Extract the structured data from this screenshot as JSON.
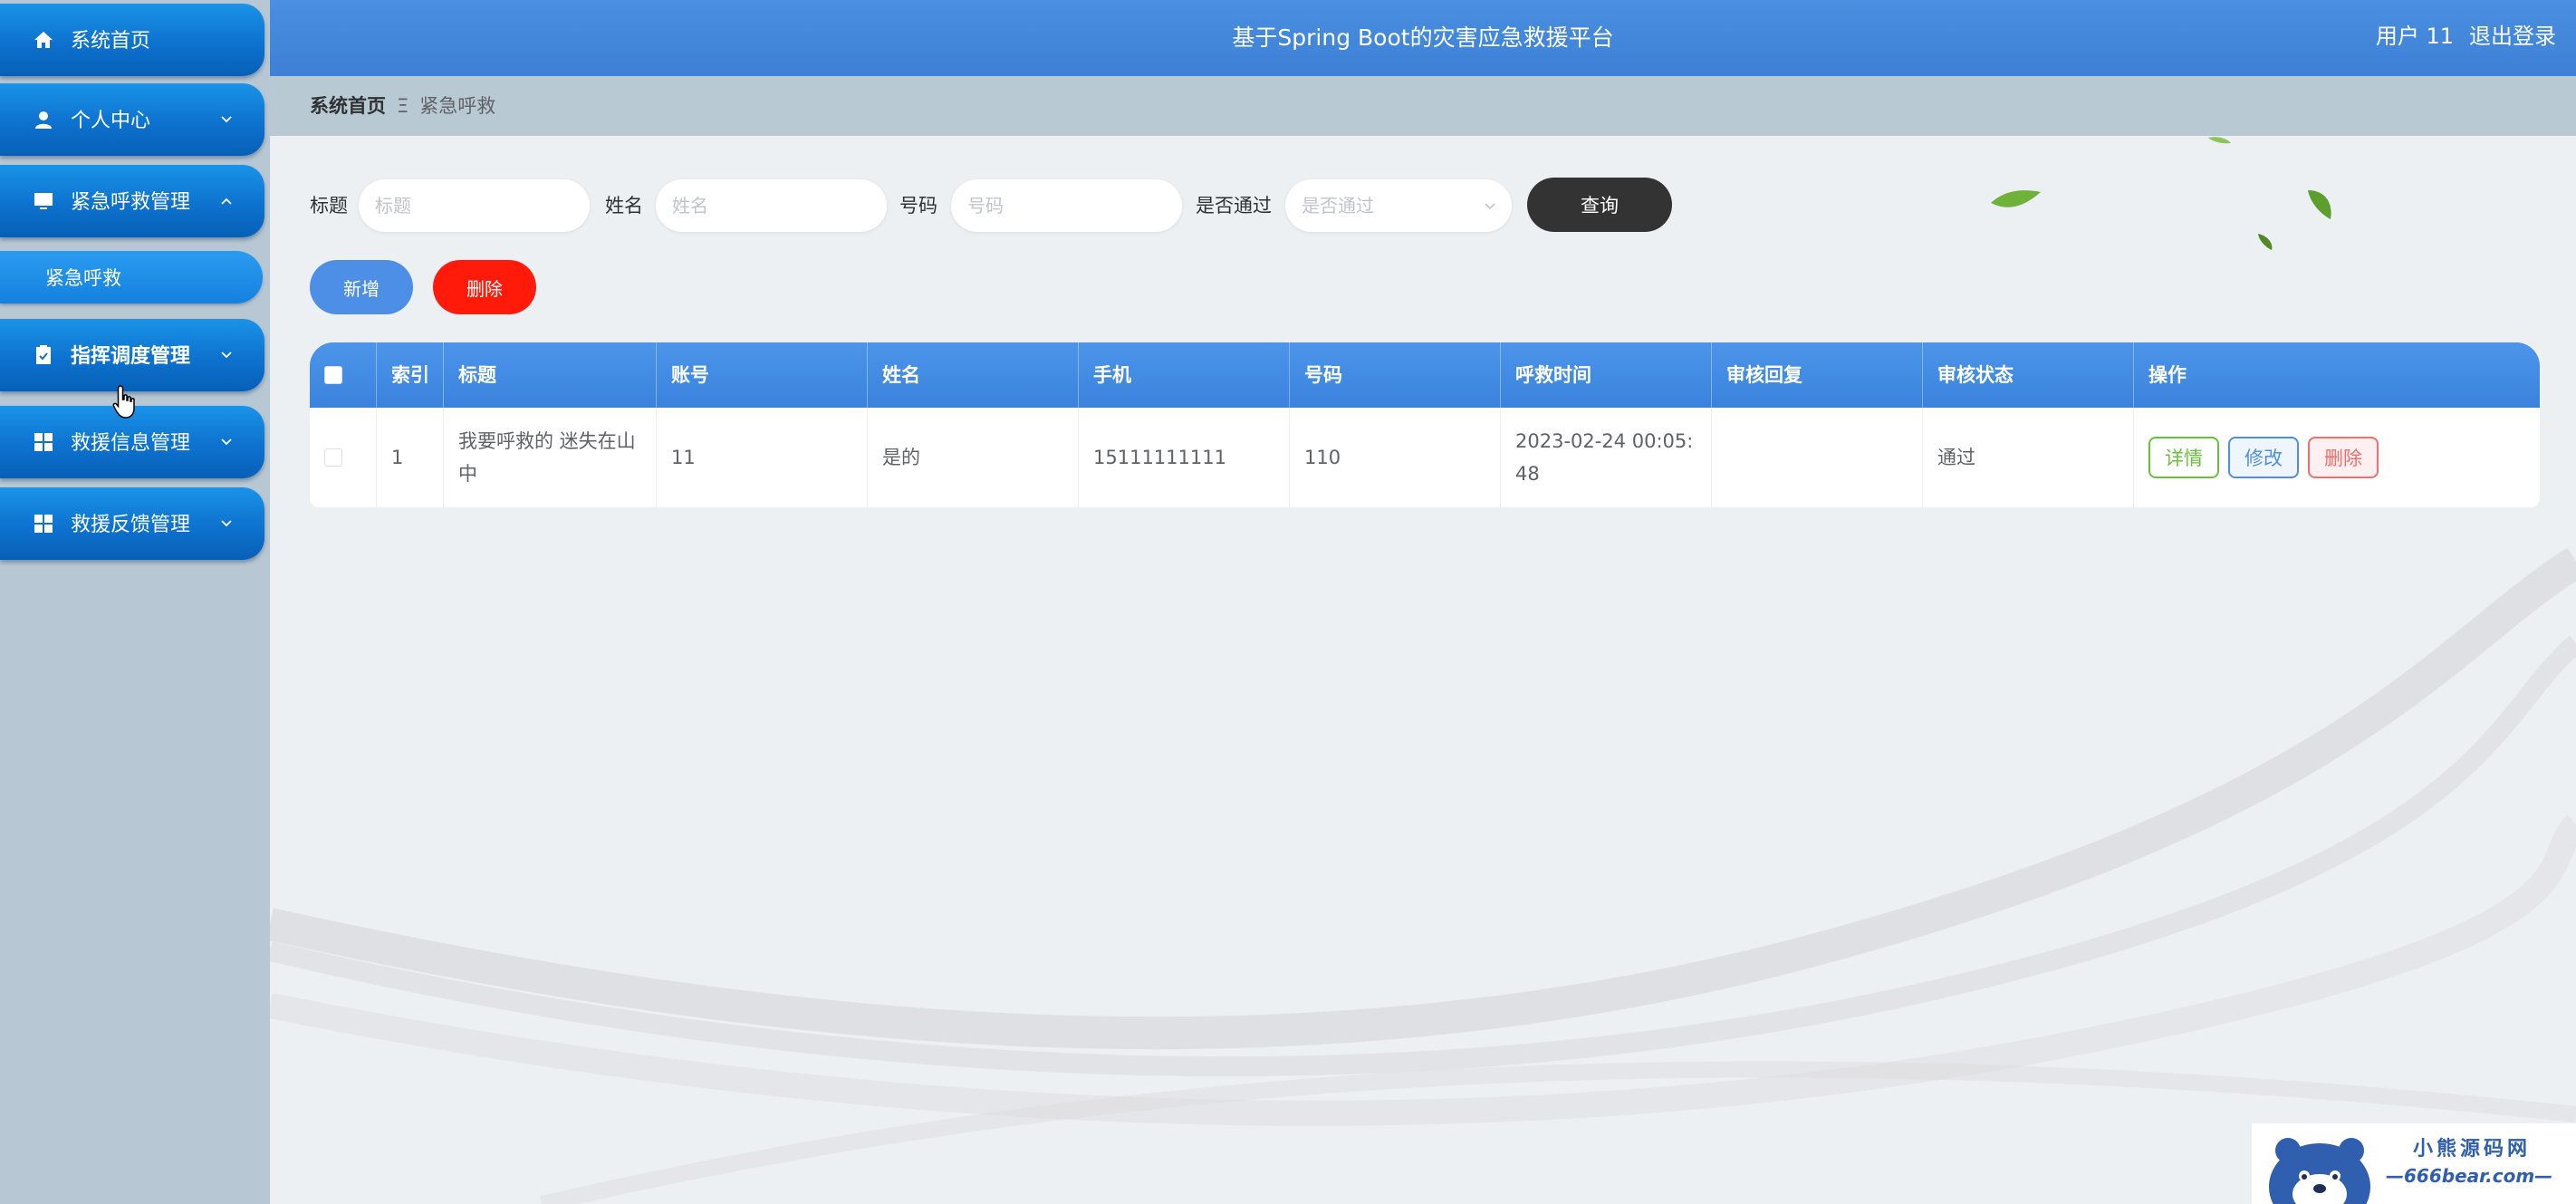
{
  "header": {
    "title": "基于Spring Boot的灾害应急救援平台",
    "user": "用户 11",
    "logout": "退出登录"
  },
  "sidebar": {
    "items": [
      {
        "label": "系统首页",
        "icon": "home-icon"
      },
      {
        "label": "个人中心",
        "icon": "user-icon"
      },
      {
        "label": "紧急呼救管理",
        "icon": "monitor-icon"
      },
      {
        "label": "指挥调度管理",
        "icon": "clipboard-icon"
      },
      {
        "label": "救援信息管理",
        "icon": "grid-icon"
      },
      {
        "label": "救援反馈管理",
        "icon": "grid-icon"
      }
    ],
    "submenu": {
      "label": "紧急呼救"
    }
  },
  "breadcrumb": {
    "home": "系统首页",
    "separator": "Ξ",
    "current": "紧急呼救"
  },
  "search": {
    "title_label": "标题",
    "title_placeholder": "标题",
    "name_label": "姓名",
    "name_placeholder": "姓名",
    "number_label": "号码",
    "number_placeholder": "号码",
    "approved_label": "是否通过",
    "approved_placeholder": "是否通过",
    "query_button": "查询"
  },
  "actions": {
    "add": "新增",
    "delete": "删除"
  },
  "table": {
    "columns": [
      "索引",
      "标题",
      "账号",
      "姓名",
      "手机",
      "号码",
      "呼救时间",
      "审核回复",
      "审核状态",
      "操作"
    ],
    "rows": [
      {
        "index": "1",
        "title": "我要呼救的 迷失在山中",
        "account": "11",
        "name": "是的",
        "phone": "15111111111",
        "number": "110",
        "time": "2023-02-24 00:05:48",
        "reply": "",
        "status": "通过",
        "ops": {
          "detail": "详情",
          "edit": "修改",
          "delete": "删除"
        }
      }
    ]
  },
  "watermark": {
    "line1": "小熊源码网",
    "line2": "—666bear.com—"
  },
  "colors": {
    "header": "#4a8fe0",
    "sidebar_item": "#0d72cf",
    "query_button": "#333333",
    "add_button": "#4d8fe6",
    "delete_button": "#ff1a0a"
  }
}
